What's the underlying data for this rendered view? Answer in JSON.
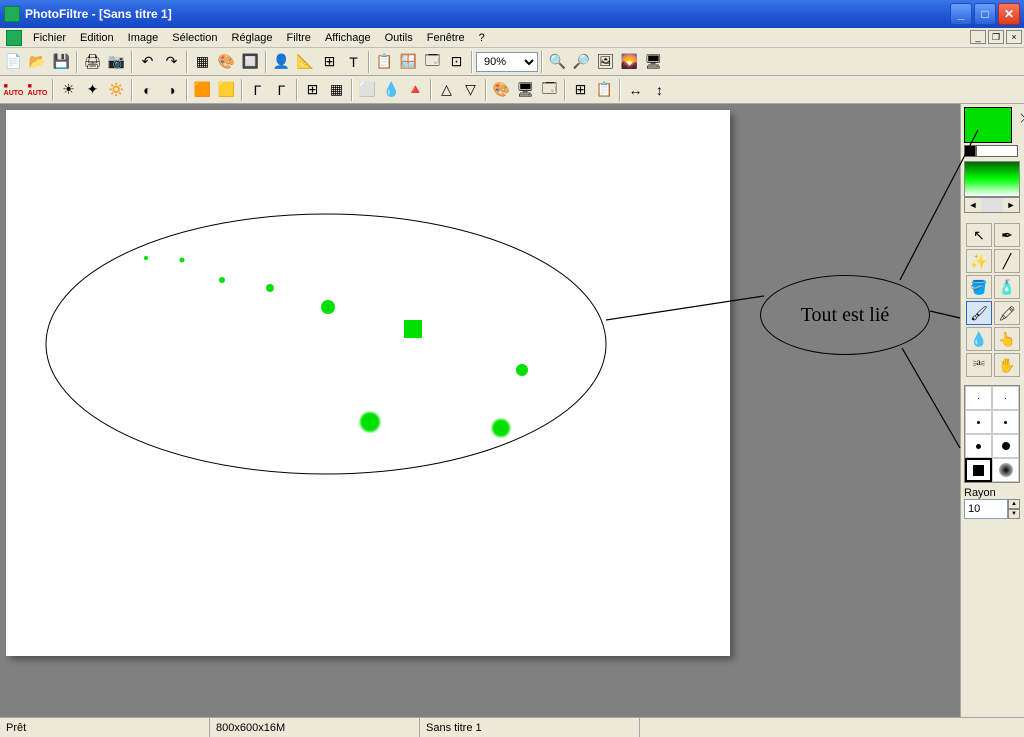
{
  "titlebar": {
    "app": "PhotoFiltre",
    "doc": "[Sans titre 1]"
  },
  "menu": [
    "Fichier",
    "Edition",
    "Image",
    "Sélection",
    "Réglage",
    "Filtre",
    "Affichage",
    "Outils",
    "Fenêtre",
    "?"
  ],
  "toolbar1_icons": [
    "📄",
    "📂",
    "💾",
    "|",
    "🖨",
    "📷",
    "|",
    "↶",
    "↷",
    "|",
    "▦",
    "🎨",
    "🔲",
    "|",
    "👤",
    "📐",
    "⊞",
    "T",
    "|",
    "📋",
    "🪟",
    "🗔",
    "⊡",
    "|"
  ],
  "zoom": "90%",
  "toolbar1_icons_b": [
    "🔍",
    "🔎",
    "🖼",
    "🌄",
    "🖥"
  ],
  "toolbar2_icons": [
    "AUTO",
    "AUTO",
    "|",
    "☀",
    "✦",
    "🔅",
    "|",
    "◐",
    "◑",
    "|",
    "🟧",
    "🟨",
    "|",
    "Γ",
    "Γ",
    "|",
    "⊞",
    "▦",
    "|",
    "⬜",
    "💧",
    "🔺",
    "|",
    "△",
    "▽",
    "|",
    "🎨",
    "🖥",
    "🗔",
    "|",
    "⊞",
    "📋",
    "|",
    "↔",
    "↕"
  ],
  "annotation_text": "Tout est lié",
  "rightpanel": {
    "rayon_label": "Rayon",
    "rayon_value": "10"
  },
  "statusbar": {
    "ready": "Prêt",
    "dims": "800x600x16M",
    "doc": "Sans titre 1"
  }
}
